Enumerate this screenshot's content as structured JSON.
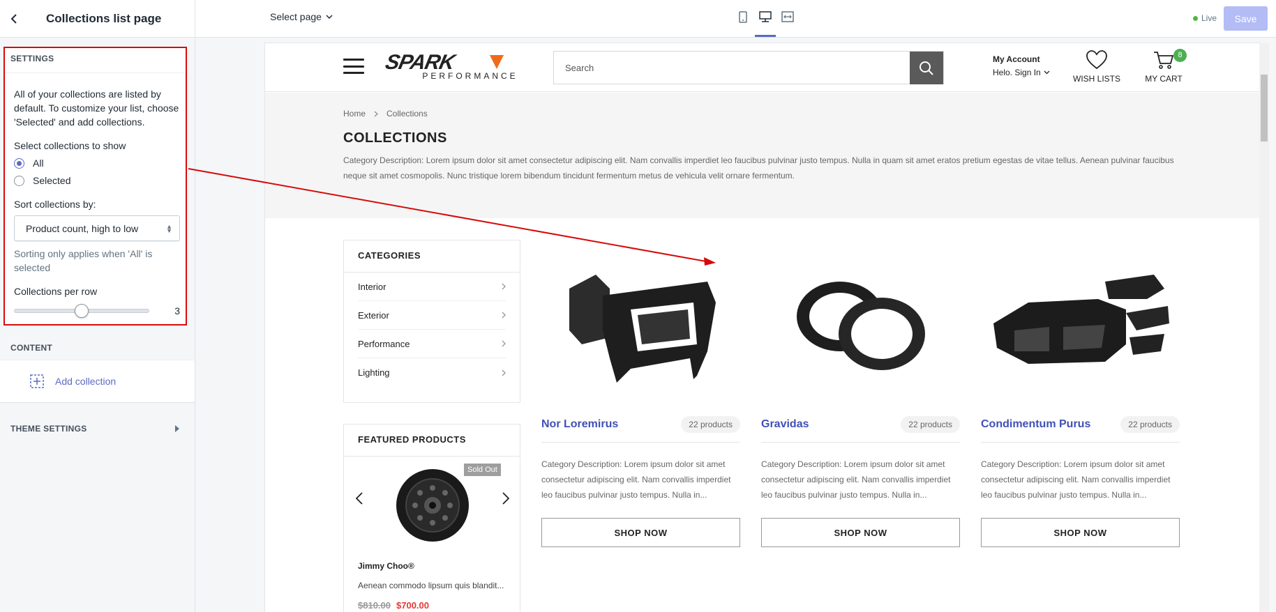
{
  "editor": {
    "title": "Collections list page",
    "settings": {
      "heading": "SETTINGS",
      "description": "All of your collections are listed by default. To customize your list, choose 'Selected' and add collections.",
      "select_label": "Select collections to show",
      "radio_options": [
        "All",
        "Selected"
      ],
      "radio_selected": "All",
      "sort_label": "Sort collections by:",
      "sort_value": "Product count, high to low",
      "sort_help": "Sorting only applies when 'All' is selected",
      "per_row_label": "Collections per row",
      "per_row_value": "3",
      "per_row_fraction": 0.5
    },
    "content": {
      "heading": "CONTENT",
      "add_label": "Add collection"
    },
    "theme_settings": "THEME SETTINGS"
  },
  "topbar": {
    "select_page": "Select page",
    "live": "Live",
    "save": "Save"
  },
  "store": {
    "logo_sub": "PERFORMANCE",
    "search_placeholder": "Search",
    "account_title": "My Account",
    "account_sub": "Helo. Sign In",
    "wishlists": "WISH LISTS",
    "cart": "MY CART",
    "cart_count": "8",
    "breadcrumb": [
      "Home",
      "Collections"
    ],
    "page_title": "COLLECTIONS",
    "page_desc": "Category Description: Lorem ipsum dolor sit amet consectetur adipiscing elit. Nam convallis imperdiet leo faucibus pulvinar justo tempus. Nulla in quam sit amet eratos pretium egestas de vitae tellus. Aenean pulvinar faucibus neque sit amet cosmopolis. Nunc tristique lorem bibendum tincidunt fermentum metus de vehicula velit ornare fermentum.",
    "categories": {
      "title": "CATEGORIES",
      "items": [
        "Interior",
        "Exterior",
        "Performance",
        "Lighting"
      ]
    },
    "featured": {
      "title": "FEATURED PRODUCTS",
      "badge": "Sold Out",
      "name": "Jimmy Choo®",
      "desc": "Aenean commodo lipsum quis blandit...",
      "old_price": "$810.00",
      "new_price": "$700.00"
    },
    "collections": [
      {
        "name": "Nor Loremirus",
        "count": "22 products",
        "desc": "Category Description: Lorem ipsum dolor sit amet consectetur adipiscing elit. Nam convallis imperdiet leo faucibus pulvinar justo tempus. Nulla in...",
        "button": "SHOP NOW",
        "image": "dash-panel-image"
      },
      {
        "name": "Gravidas",
        "count": "22 products",
        "desc": "Category Description: Lorem ipsum dolor sit amet consectetur adipiscing elit. Nam convallis imperdiet leo faucibus pulvinar justo tempus. Nulla in...",
        "button": "SHOP NOW",
        "image": "speaker-rings-image"
      },
      {
        "name": "Condimentum Purus",
        "count": "22 products",
        "desc": "Category Description: Lorem ipsum dolor sit amet consectetur adipiscing elit. Nam convallis imperdiet leo faucibus pulvinar justo tempus. Nulla in...",
        "button": "SHOP NOW",
        "image": "body-kit-image"
      }
    ]
  },
  "colors": {
    "accent": "#5c6ac4",
    "annotation": "#d70a0a",
    "collection_link": "#3f51b5",
    "sale_price": "#e53935",
    "cart_badge": "#4caf50",
    "logo_orange": "#f06a1d"
  }
}
